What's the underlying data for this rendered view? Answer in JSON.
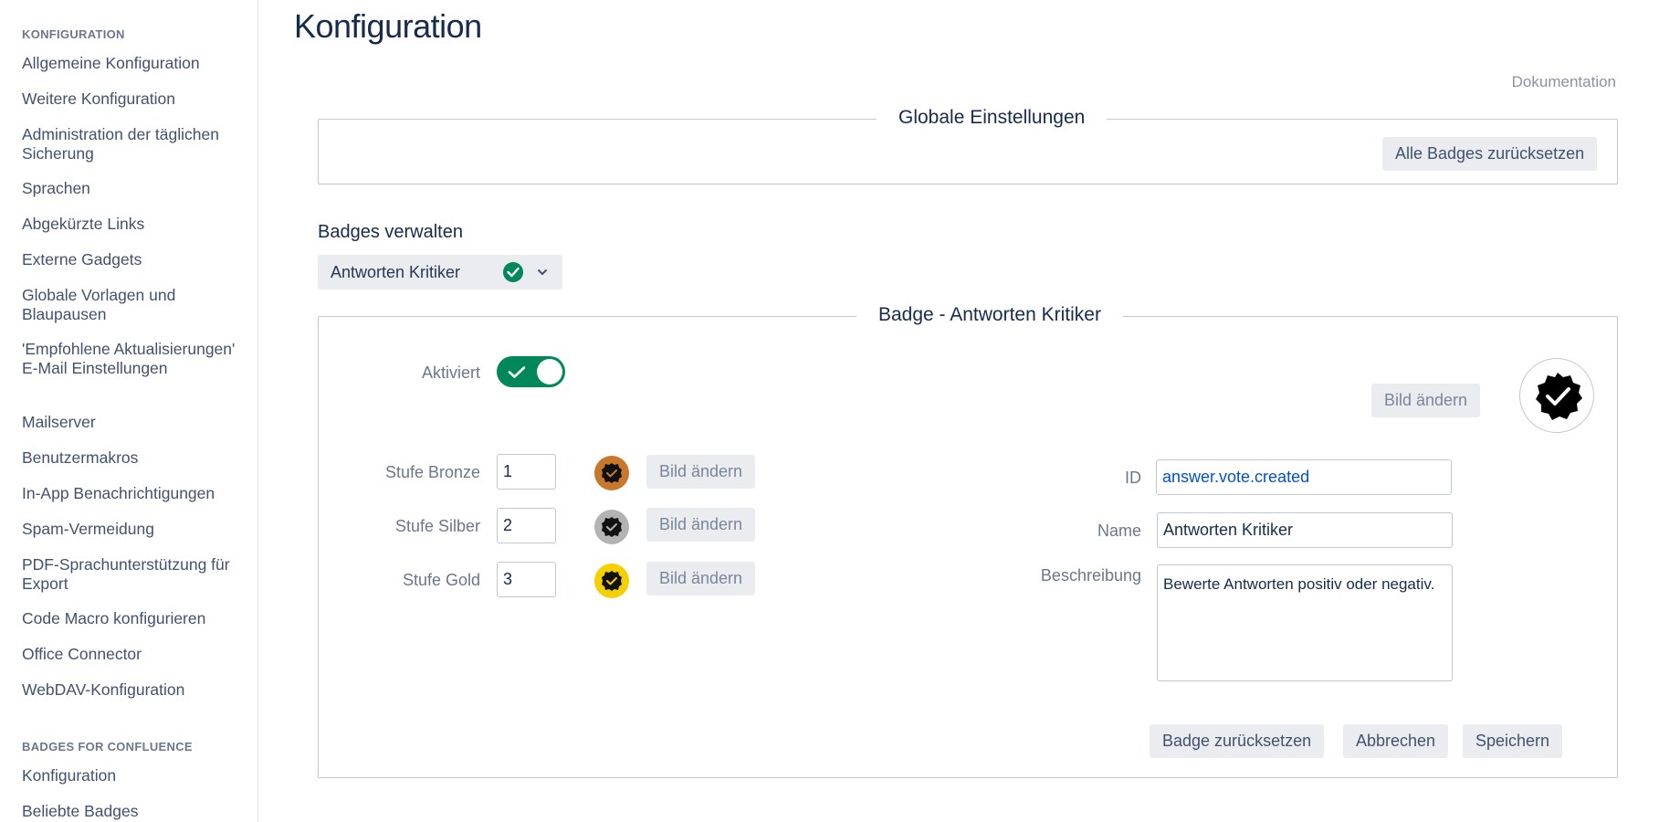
{
  "sidebar": {
    "section1": "KONFIGURATION",
    "items": [
      {
        "label": "Allgemeine Konfiguration"
      },
      {
        "label": "Weitere Konfiguration"
      },
      {
        "label": "Administration der täglichen Sicherung"
      },
      {
        "label": "Sprachen"
      },
      {
        "label": "Abgekürzte Links"
      },
      {
        "label": "Externe Gadgets"
      },
      {
        "label": "Globale Vorlagen und Blaupausen"
      },
      {
        "label": "'Empfohlene Aktualisierungen' E-Mail Einstellungen"
      },
      {
        "label": "Mailserver"
      },
      {
        "label": "Benutzermakros"
      },
      {
        "label": "In-App Benachrichtigungen"
      },
      {
        "label": "Spam-Vermeidung"
      },
      {
        "label": "PDF-Sprachunterstützung für Export"
      },
      {
        "label": "Code Macro konfigurieren"
      },
      {
        "label": "Office Connector"
      },
      {
        "label": "WebDAV-Konfiguration"
      }
    ],
    "section2": "BADGES FOR CONFLUENCE",
    "items2": [
      {
        "label": "Konfiguration"
      },
      {
        "label": "Beliebte Badges"
      }
    ]
  },
  "main": {
    "title": "Konfiguration",
    "doc_link": "Dokumentation",
    "global": {
      "legend": "Globale Einstellungen",
      "reset_all": "Alle Badges zurücksetzen"
    },
    "manage": {
      "title": "Badges verwalten",
      "selected": "Antworten Kritiker"
    },
    "badge": {
      "legend": "Badge - Antworten Kritiker",
      "activated_label": "Aktiviert",
      "activated": true,
      "change_image": "Bild ändern",
      "levels": [
        {
          "label": "Stufe Bronze",
          "value": "1",
          "color": "#c8782a",
          "button": "Bild ändern"
        },
        {
          "label": "Stufe Silber",
          "value": "2",
          "color": "#b3b3b3",
          "button": "Bild ändern"
        },
        {
          "label": "Stufe Gold",
          "value": "3",
          "color": "#f5d000",
          "button": "Bild ändern"
        }
      ],
      "id_label": "ID",
      "id_value": "answer.vote.created",
      "name_label": "Name",
      "name_value": "Antworten Kritiker",
      "desc_label": "Beschreibung",
      "desc_value": "Bewerte Antworten positiv oder negativ.",
      "reset": "Badge zurücksetzen",
      "cancel": "Abbrechen",
      "save": "Speichern"
    }
  },
  "colors": {
    "accent_green": "#00875a",
    "link_blue": "#0052cc",
    "button_bg": "#ebecf0"
  }
}
